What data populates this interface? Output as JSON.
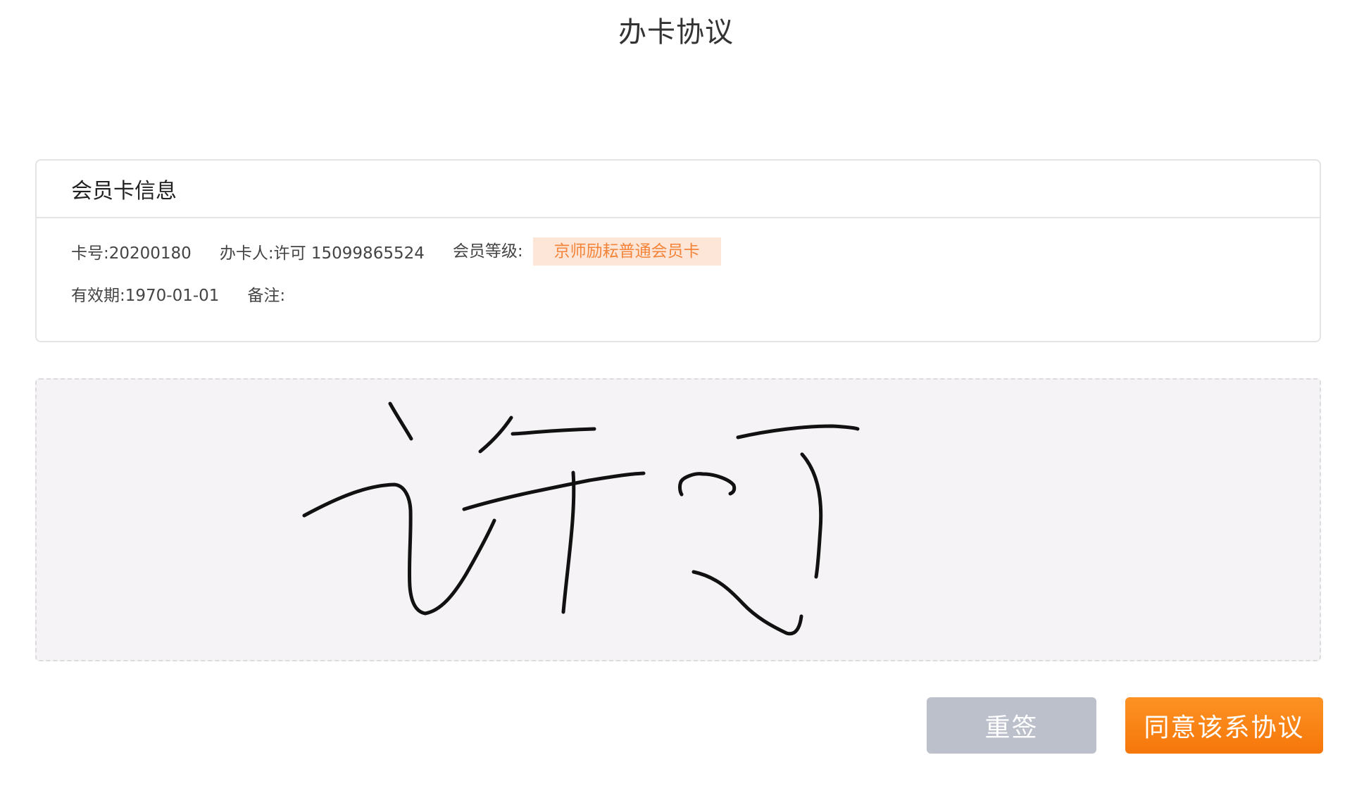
{
  "page": {
    "title": "办卡协议"
  },
  "card": {
    "header": "会员卡信息",
    "card_no_label": "卡号:",
    "card_no": "20200180",
    "holder_label": "办卡人:",
    "holder": "许可 15099865524",
    "level_label": "会员等级:",
    "level": "京师励耘普通会员卡",
    "expiry_label": "有效期:",
    "expiry": "1970-01-01",
    "remark_label": "备注:",
    "remark": ""
  },
  "signature": {
    "ink_color": "#111111"
  },
  "actions": {
    "resign_label": "重签",
    "agree_label": "同意该系协议"
  },
  "colors": {
    "accent": "#f6760a",
    "badge_bg": "#fde6d8",
    "badge_text": "#f3843a",
    "resign_bg": "#bcc0cb",
    "sign_bg": "#f6f3f6"
  }
}
